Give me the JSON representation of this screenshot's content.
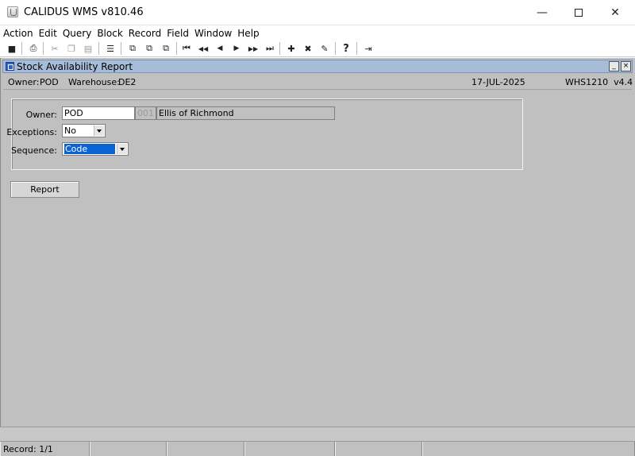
{
  "window": {
    "title": "CALIDUS WMS v810.46",
    "minimize_glyph": "—",
    "close_glyph": "✕"
  },
  "menu": [
    "Action",
    "Edit",
    "Query",
    "Block",
    "Record",
    "Field",
    "Window",
    "Help"
  ],
  "toolbar": {
    "icons": [
      "save-icon",
      "print-icon",
      "cut-icon",
      "copy-icon",
      "paste-icon",
      "list-icon",
      "enter-query-icon",
      "execute-query-icon",
      "cancel-query-icon",
      "first-record-icon",
      "previous-block-icon",
      "previous-record-icon",
      "next-record-icon",
      "next-block-icon",
      "last-record-icon",
      "insert-record-icon",
      "delete-record-icon",
      "clear-icon",
      "help-icon",
      "exit-icon"
    ],
    "glyphs": {
      "save": "■",
      "print": "⎙",
      "cut": "✂",
      "copy": "❐",
      "paste": "▤",
      "list": "☰",
      "enter_query": "⧉",
      "execute_query": "⧉",
      "cancel_query": "⧉",
      "first": "⏮",
      "prev_block": "◀◀",
      "prev": "◀",
      "next": "▶",
      "next_block": "▶▶",
      "last": "⏭",
      "insert": "✚",
      "delete": "✖",
      "clear": "✎",
      "help": "?",
      "exit": "⇥"
    }
  },
  "frame": {
    "title": "Stock Availability Report",
    "minimize_glyph": "_",
    "close_glyph": "×"
  },
  "info": {
    "owner_label": "Owner:",
    "owner_value": "POD",
    "warehouse_label": "Warehouse:",
    "warehouse_value": "DE2",
    "date": "17-JUL-2025",
    "program": "WHS1210  v4.4"
  },
  "form": {
    "owner_label": "Owner:",
    "owner_value": "POD",
    "owner_code": "001",
    "owner_name": "Ellis of Richmond",
    "exceptions_label": "Exceptions:",
    "exceptions_value": "No",
    "sequence_label": "Sequence:",
    "sequence_value": "Code"
  },
  "buttons": {
    "report": "Report"
  },
  "status": {
    "record": "Record: 1/1"
  }
}
